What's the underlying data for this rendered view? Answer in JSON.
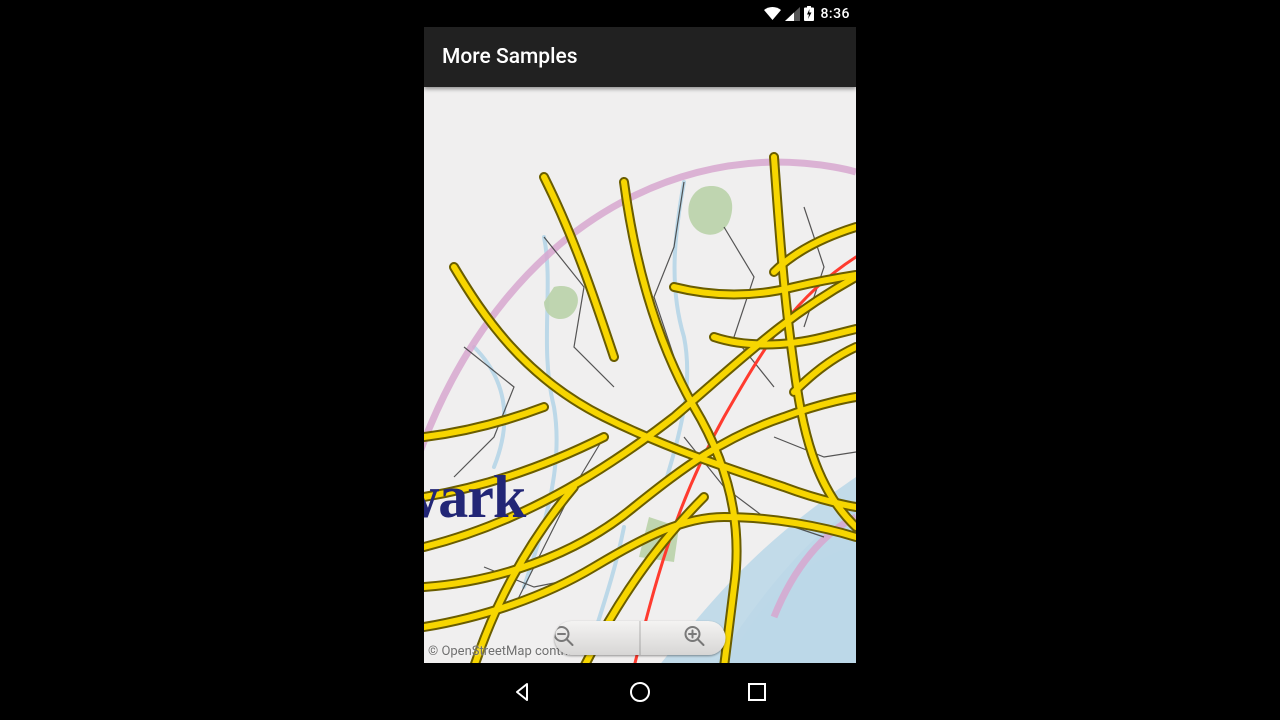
{
  "status_bar": {
    "time": "8:36"
  },
  "app_bar": {
    "title": "More Samples"
  },
  "map": {
    "city_label": "Newark",
    "attribution": "© OpenStreetMap contributors",
    "zoom_out_label": "−",
    "zoom_in_label": "+"
  },
  "colors": {
    "road_major": "#f7d600",
    "road_highlight": "#ff3b2f",
    "water": "#bcd8e8",
    "boundary": "#d7a7cf",
    "park": "#b9d2a8",
    "label": "#222676"
  }
}
